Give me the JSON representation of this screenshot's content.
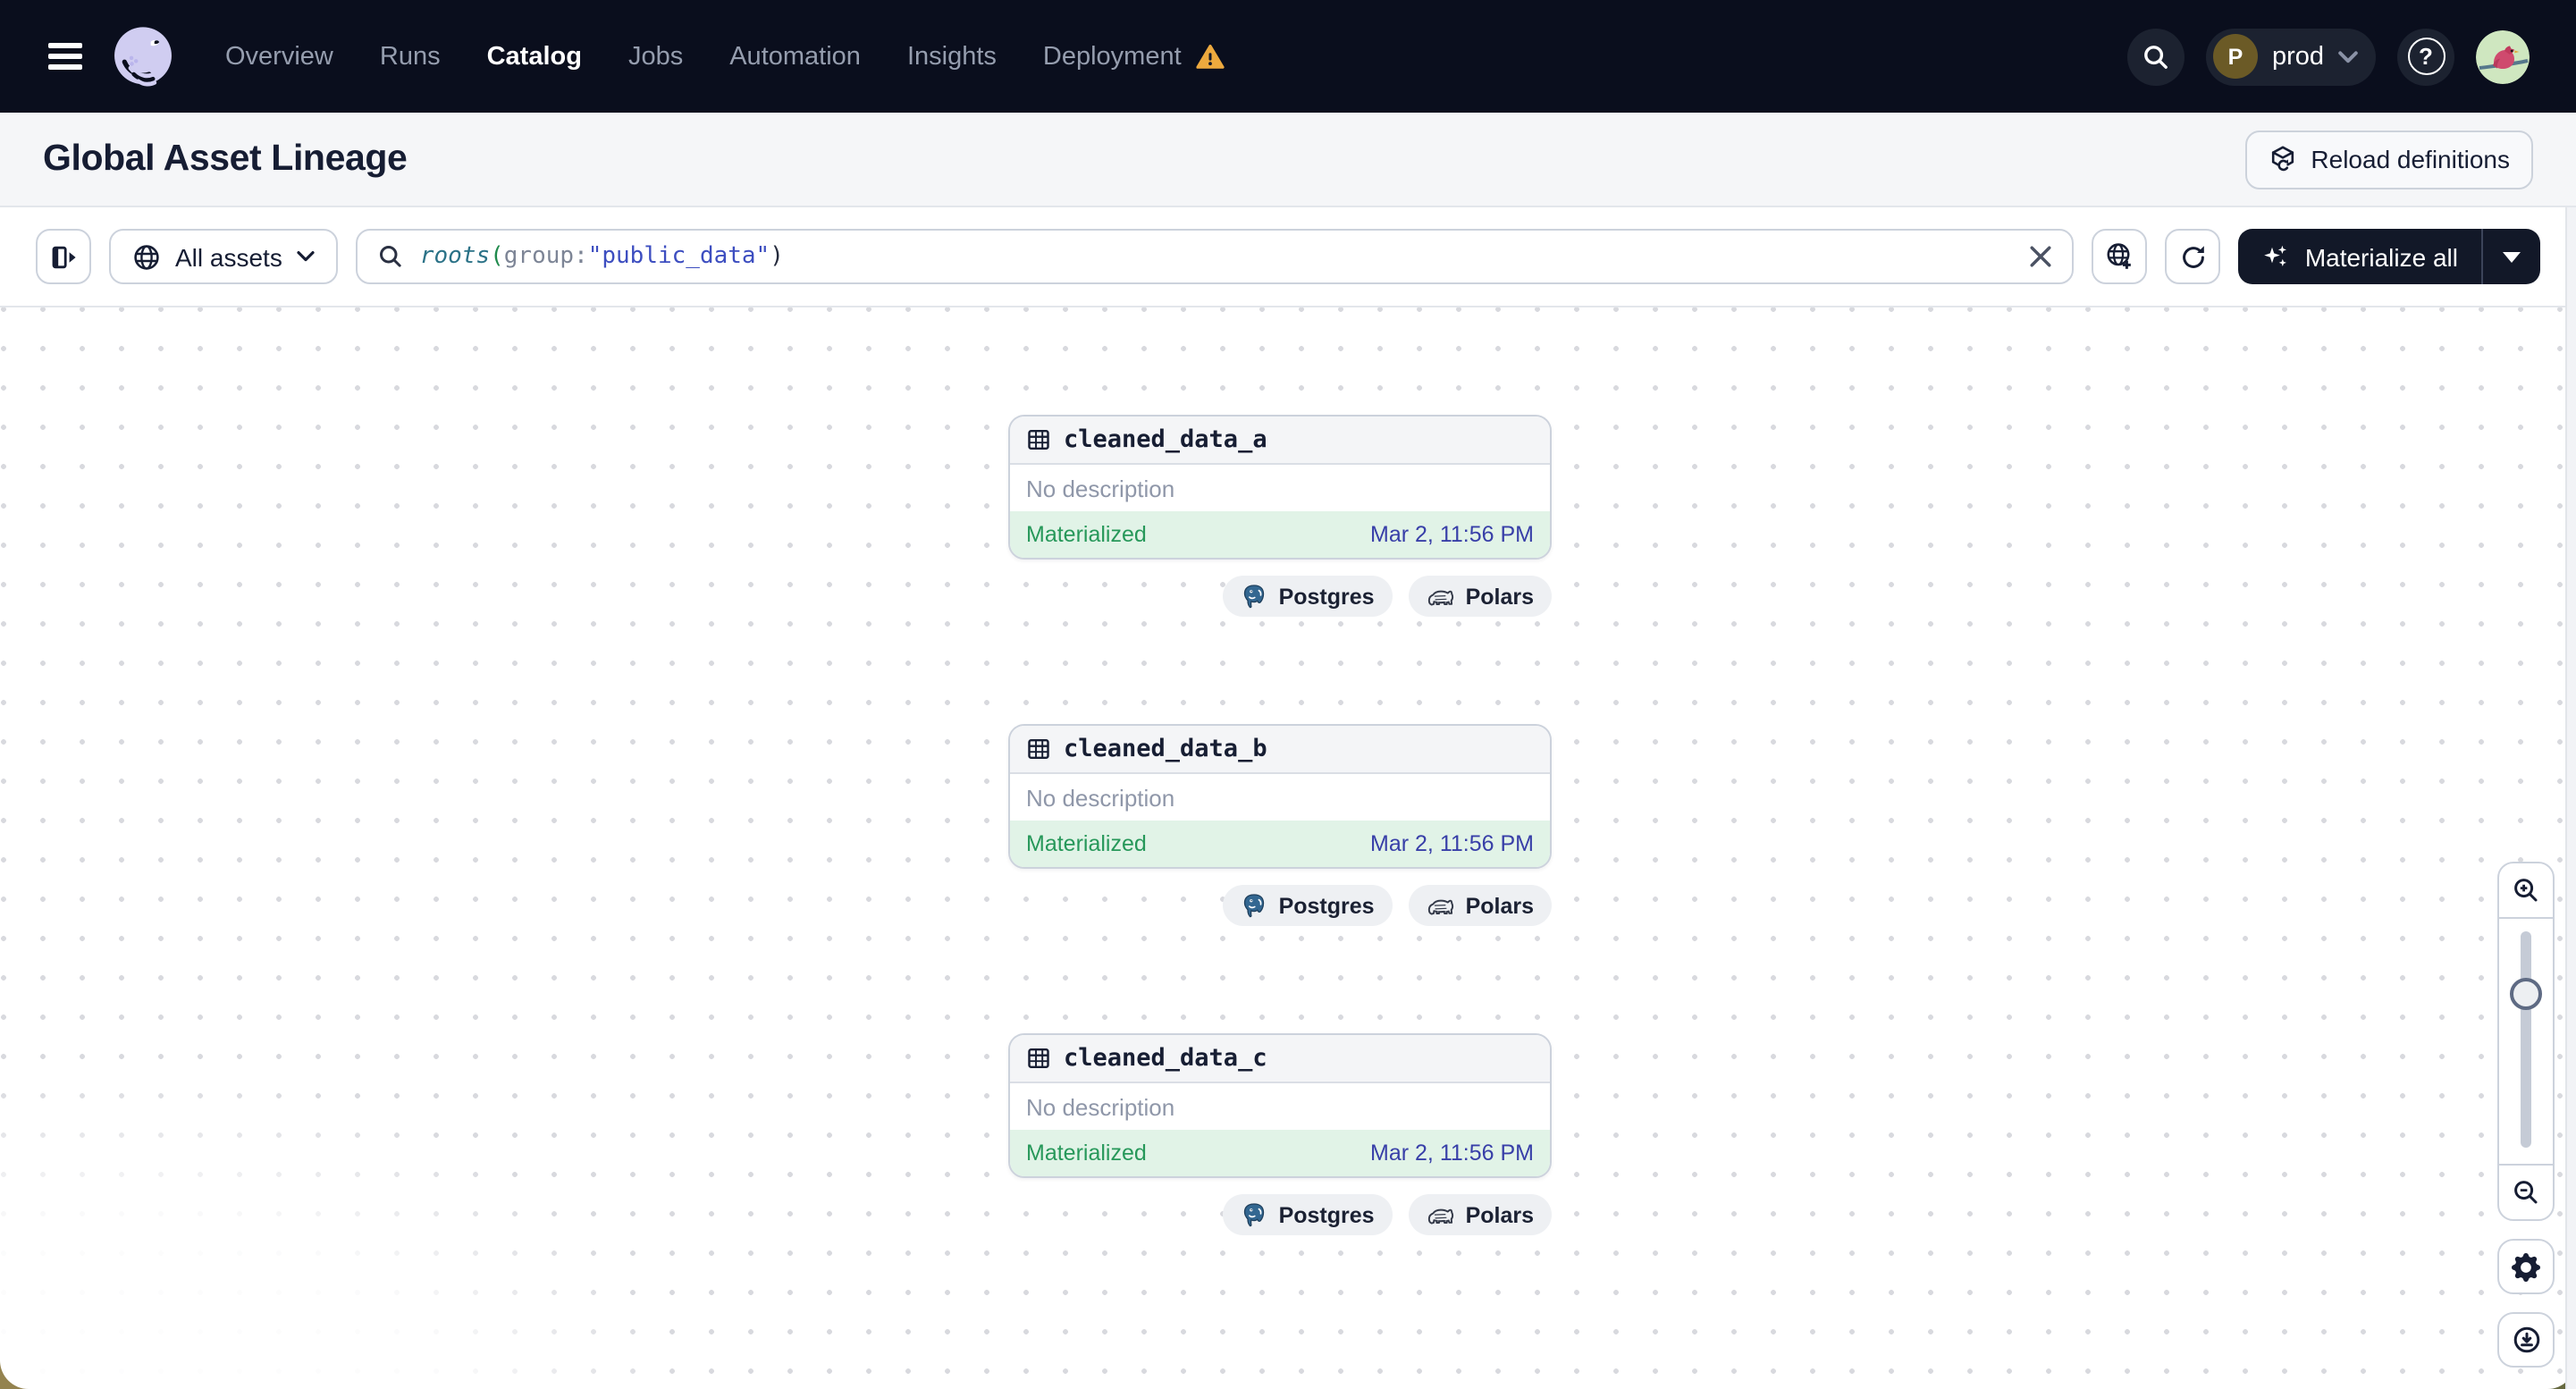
{
  "nav": {
    "items": [
      {
        "label": "Overview",
        "active": false,
        "warning": false
      },
      {
        "label": "Runs",
        "active": false,
        "warning": false
      },
      {
        "label": "Catalog",
        "active": true,
        "warning": false
      },
      {
        "label": "Jobs",
        "active": false,
        "warning": false
      },
      {
        "label": "Automation",
        "active": false,
        "warning": false
      },
      {
        "label": "Insights",
        "active": false,
        "warning": false
      },
      {
        "label": "Deployment",
        "active": false,
        "warning": true
      }
    ],
    "environment": {
      "initial": "P",
      "name": "prod"
    },
    "help_glyph": "?"
  },
  "header": {
    "title": "Global Asset Lineage",
    "reload_button": "Reload definitions"
  },
  "toolbar": {
    "scope_label": "All assets",
    "materialize_label": "Materialize all",
    "query_segments": [
      {
        "text": "roots",
        "style": "fn"
      },
      {
        "text": "(",
        "style": "paren-green"
      },
      {
        "text": "group",
        "style": "plain"
      },
      {
        "text": ":",
        "style": "plain"
      },
      {
        "text": "\"public_data\"",
        "style": "string"
      },
      {
        "text": ")",
        "style": "dark"
      }
    ]
  },
  "graph": {
    "nodes": [
      {
        "name": "cleaned_data_a",
        "description": "No description",
        "status": "Materialized",
        "timestamp": "Mar 2, 11:56 PM",
        "tags": [
          "Postgres",
          "Polars"
        ]
      },
      {
        "name": "cleaned_data_b",
        "description": "No description",
        "status": "Materialized",
        "timestamp": "Mar 2, 11:56 PM",
        "tags": [
          "Postgres",
          "Polars"
        ]
      },
      {
        "name": "cleaned_data_c",
        "description": "No description",
        "status": "Materialized",
        "timestamp": "Mar 2, 11:56 PM",
        "tags": [
          "Postgres",
          "Polars"
        ]
      }
    ]
  },
  "colors": {
    "nav_bg": "#0a0e1d",
    "accent_dark": "#121828",
    "status_green": "#27985a",
    "status_green_bg": "#e1f3e7",
    "timestamp_indigo": "#383fa8",
    "warning_orange": "#eda93e",
    "query_fn_teal": "#2b7287",
    "query_string_indigo": "#3d4ec0",
    "query_paren_green": "#1f8a4c",
    "logo_lavender": "#d0cdf1",
    "postgres_blue": "#336791"
  }
}
